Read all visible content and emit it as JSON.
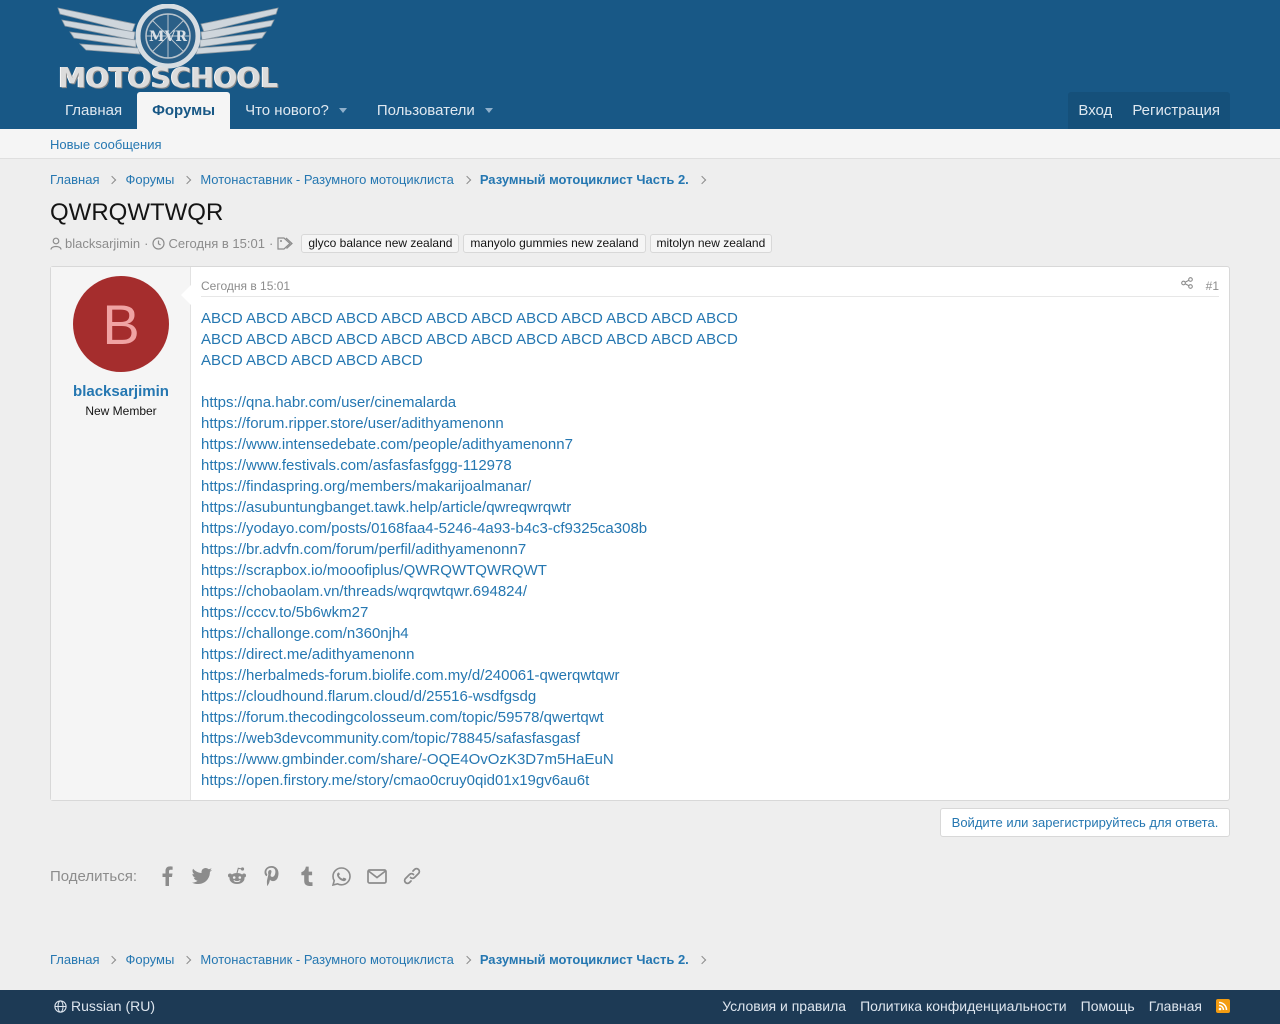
{
  "header": {
    "logo_text": "MOTOSCHOOL",
    "nav": [
      {
        "label": "Главная"
      },
      {
        "label": "Форумы"
      },
      {
        "label": "Что нового?"
      },
      {
        "label": "Пользователи"
      }
    ],
    "login_label": "Вход",
    "register_label": "Регистрация"
  },
  "subnav": {
    "new_posts": "Новые сообщения"
  },
  "breadcrumbs": [
    "Главная",
    "Форумы",
    "Мотонаставник - Разумного мотоциклиста",
    "Разумный мотоциклист Часть 2."
  ],
  "thread": {
    "title": "QWRQWTWQR",
    "author": "blacksarjimin",
    "date": "Сегодня в 15:01",
    "tags": [
      "glyco balance new zealand",
      "manyolo gummies new zealand",
      "mitolyn new zealand"
    ]
  },
  "post": {
    "avatar_letter": "B",
    "username": "blacksarjimin",
    "user_title": "New Member",
    "date": "Сегодня в 15:01",
    "number": "#1",
    "abcd_text": "ABCD ABCD ABCD ABCD ABCD ABCD ABCD ABCD ABCD ABCD ABCD ABCD ABCD ABCD ABCD ABCD ABCD ABCD ABCD ABCD ABCD ABCD ABCD ABCD ABCD ABCD ABCD ABCD ABCD",
    "links": [
      "https://qna.habr.com/user/cinemalarda",
      "https://forum.ripper.store/user/adithyamenonn",
      "https://www.intensedebate.com/people/adithyamenonn7",
      "https://www.festivals.com/asfasfasfggg-112978",
      "https://findaspring.org/members/makarijoalmanar/",
      "https://asubuntungbanget.tawk.help/article/qwreqwrqwtr",
      "https://yodayo.com/posts/0168faa4-5246-4a93-b4c3-cf9325ca308b",
      "https://br.advfn.com/forum/perfil/adithyamenonn7",
      "https://scrapbox.io/mooofiplus/QWRQWTQWRQWT",
      "https://chobaolam.vn/threads/wqrqwtqwr.694824/",
      "https://cccv.to/5b6wkm27",
      "https://challonge.com/n360njh4",
      "https://direct.me/adithyamenonn",
      "https://herbalmeds-forum.biolife.com.my/d/240061-qwerqwtqwr",
      "https://cloudhound.flarum.cloud/d/25516-wsdfgsdg",
      "https://forum.thecodingcolosseum.com/topic/59578/qwertqwt",
      "https://web3devcommunity.com/topic/78845/safasfasgasf",
      "https://www.gmbinder.com/share/-OQE4OvOzK3D7m5HaEuN",
      "https://open.firstory.me/story/cmao0cruy0qid01x19gv6au6t"
    ]
  },
  "reply_label": "Войдите или зарегистрируйтесь для ответа.",
  "share": {
    "label": "Поделиться:",
    "icons": [
      "facebook-icon",
      "twitter-icon",
      "reddit-icon",
      "pinterest-icon",
      "tumblr-icon",
      "whatsapp-icon",
      "email-icon",
      "link-icon"
    ]
  },
  "footer": {
    "language": "Russian (RU)",
    "links": [
      "Условия и правила",
      "Политика конфиденциальности",
      "Помощь",
      "Главная"
    ]
  },
  "colors": {
    "header_bg": "#185886",
    "link": "#2577b1",
    "footer_bg": "#1d3a55",
    "avatar_bg": "#a52d2d",
    "rss": "#f39c12"
  }
}
